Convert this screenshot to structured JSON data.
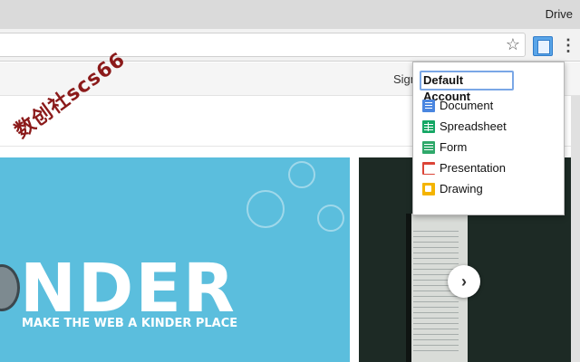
{
  "window": {
    "title": "Drive"
  },
  "page": {
    "sign_in_label": "Sign",
    "watermark": "数创社scs66",
    "banner": {
      "headline": "NDER",
      "tagline": "MAKE THE WEB A KINDER PLACE"
    },
    "next_arrow": "›"
  },
  "toolbar": {
    "bookmark_icon": "☆",
    "menu_icon": "⋮"
  },
  "popup": {
    "account": "Default Account",
    "items": [
      {
        "label": "Document",
        "icon": "document-icon",
        "color": "#4a86e0"
      },
      {
        "label": "Spreadsheet",
        "icon": "spreadsheet-icon",
        "color": "#16a765"
      },
      {
        "label": "Form",
        "icon": "form-icon",
        "color": "#2fa86a"
      },
      {
        "label": "Presentation",
        "icon": "presentation-icon",
        "color": "#db4437"
      },
      {
        "label": "Drawing",
        "icon": "drawing-icon",
        "color": "#f4b400"
      }
    ]
  }
}
